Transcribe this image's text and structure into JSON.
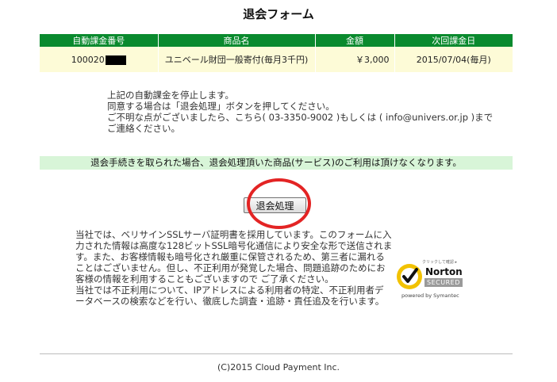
{
  "page": {
    "title": "退会フォーム"
  },
  "table": {
    "headers": [
      "自動課金番号",
      "商品名",
      "金額",
      "次回課金日"
    ],
    "row": {
      "billing_number": "100020",
      "product_name": "ユニベール財団一般寄付(毎月3千円)",
      "amount": "￥3,000",
      "next_billing_date": "2015/07/04(毎月)"
    }
  },
  "notice": {
    "lines": [
      "上記の自動課金を停止します。",
      "同意する場合は「退会処理」ボタンを押してください。",
      "ご不明な点がございましたら、こちら( 03-3350-9002 )もしくは ( info@univers.or.jp )までご連絡ください。"
    ]
  },
  "warning": "退会手続きを取られた場合、退会処理頂いた商品(サービス)のご利用は頂けなくなります。",
  "button": {
    "label": "退会処理"
  },
  "ssl_text": {
    "paragraph1": "当社では、ベリサインSSLサーバ証明書を採用しています。このフォームに入力された情報は高度な128ビットSSL暗号化通信により安全な形で送信されます。また、お客様情報も暗号化され厳重に保管されるため、第三者に漏れることはございません。但し、不正利用が発覚した場合、問題追跡のためにお客様の情報を利用することもございますので ご了承ください。",
    "paragraph2": "当社では不正利用について、IPアドレスによる利用者の特定、不正利用者データベースの検索などを行い、徹底した調査・追跡・責任追及を行います。"
  },
  "norton_seal": {
    "small_text": "クリックして確認 ▸",
    "brand": "Norton",
    "secured": "SECURED",
    "powered": "powered by Symantec"
  },
  "footer": "(C)2015 Cloud Payment Inc."
}
